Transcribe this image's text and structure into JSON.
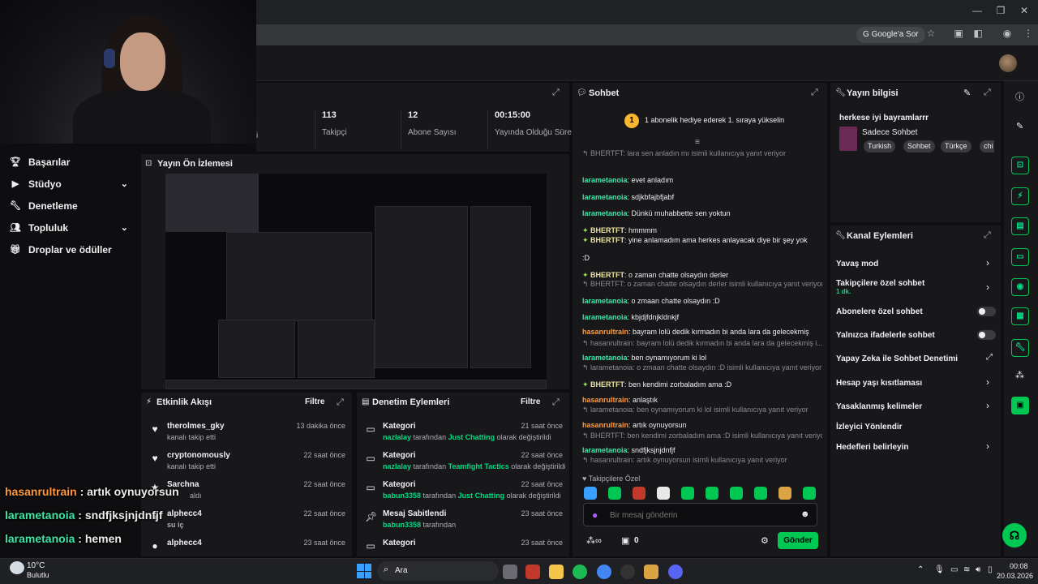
{
  "browser": {
    "google_sor": "Google'a Sor"
  },
  "nav": {
    "items": [
      {
        "label": "Başarılar",
        "icon": "trophy-icon"
      },
      {
        "label": "Stüdyo",
        "icon": "video-icon"
      },
      {
        "label": "Denetleme",
        "icon": "wrench-icon"
      },
      {
        "label": "Topluluk",
        "icon": "people-icon"
      },
      {
        "label": "Droplar ve ödüller",
        "icon": "gift-icon"
      }
    ]
  },
  "stats": {
    "stat2_suffix": "i",
    "items": [
      {
        "value": "113",
        "label": "Takipçi"
      },
      {
        "value": "12",
        "label": "Abone Sayısı"
      },
      {
        "value": "00:15:00",
        "label": "Yayında Olduğu Süre"
      }
    ]
  },
  "preview": {
    "title": "Yayın Ön İzlemesi"
  },
  "activity": {
    "title": "Etkinlik Akışı",
    "filter": "Filtre",
    "items": [
      {
        "user": "therolmes_gky",
        "desc": "kanalı takip etti",
        "time": "13 dakika önce"
      },
      {
        "user": "cryptonomously",
        "desc": "kanalı takip etti",
        "time": "22 saat önce"
      },
      {
        "user": "Sarchna",
        "desc": "aldı",
        "time": "22 saat önce"
      },
      {
        "user": "alphecc4",
        "desc": "su iç",
        "time": "22 saat önce"
      },
      {
        "user": "alphecc4",
        "desc": "",
        "time": "23 saat önce"
      }
    ]
  },
  "moderation": {
    "title": "Denetim Eylemleri",
    "filter": "Filtre",
    "items": [
      {
        "title": "Kategori",
        "user": "nazlalay",
        "mid": "tarafından",
        "target": "Just Chatting",
        "end": "olarak değiştirildi",
        "time": "21 saat önce"
      },
      {
        "title": "Kategori",
        "user": "nazlalay",
        "mid": "tarafından",
        "target": "Teamfight Tactics",
        "end": "olarak değiştirildi",
        "time": "22 saat önce"
      },
      {
        "title": "Kategori",
        "user": "babun3358",
        "mid": "tarafından",
        "target": "Just Chatting",
        "end": "olarak değiştirildi",
        "time": "22 saat önce"
      },
      {
        "title": "Mesaj Sabitlendi",
        "user": "babun3358",
        "mid": "tarafından",
        "target": "",
        "end": "",
        "time": "23 saat önce"
      },
      {
        "title": "Kategori",
        "user": "",
        "mid": "",
        "target": "",
        "end": "",
        "time": "23 saat önce"
      }
    ]
  },
  "overlay": [
    {
      "name": "hasanrultrain",
      "text": " : artık oynuyorsun"
    },
    {
      "name": "larametanoia",
      "text": " : sndfjksjnjdnfjf"
    },
    {
      "name": "larametanoia",
      "text": " : hemen"
    }
  ],
  "chat": {
    "title": "Sohbet",
    "pinned_rank": "1",
    "pinned_text": "1 abonelik hediye ederek 1. sıraya yükselin",
    "messages": [
      {
        "reply": "BHERTFT: lara sen anladın mı isimli kullanıcıya yanıt veriyor",
        "name": "",
        "text": "",
        "color": "g"
      },
      {
        "reply": "",
        "name": "larametanoia",
        "text": ": evet anladım",
        "color": "g"
      },
      {
        "reply": "",
        "name": "larametanoia",
        "text": ": sdjkbfajbfjabf",
        "color": "g"
      },
      {
        "reply": "",
        "name": "larametanoia",
        "text": ": Dünkü muhabbette sen yoktun",
        "color": "g"
      },
      {
        "reply": "",
        "name": "BHERTFT",
        "text": ": hmmmm",
        "color": "y"
      },
      {
        "reply": "",
        "name": "BHERTFT",
        "text": ": yine anlamadım ama herkes anlayacak diye bir şey yok",
        "color": "y"
      },
      {
        "reply": "",
        "name": "",
        "text": ":D",
        "color": "y"
      },
      {
        "reply": "",
        "name": "BHERTFT",
        "text": ": o zaman chatte olsaydın derler",
        "color": "y"
      },
      {
        "reply": "BHERTFT: o zaman chatte olsaydın derler isimli kullanıcıya yanıt veriyor",
        "name": "",
        "text": "",
        "color": "g"
      },
      {
        "reply": "",
        "name": "larametanoia",
        "text": ": o zmaan chatte olsaydın :D",
        "color": "g"
      },
      {
        "reply": "",
        "name": "larametanoia",
        "text": ": kbjdjfdnjkldnkjf",
        "color": "g"
      },
      {
        "reply": "",
        "name": "hasanrultrain",
        "text": ": bayram lolü dedik kırmadın bi anda lara da gelecekmiş",
        "color": "o"
      },
      {
        "reply": "hasanrultrain: bayram lolü dedik kırmadın bi anda lara da gelecekmiş i...",
        "name": "",
        "text": "",
        "color": "g"
      },
      {
        "reply": "",
        "name": "larametanoia",
        "text": ": ben oynamıyorum ki lol",
        "color": "g"
      },
      {
        "reply": "larametanoia: o zmaan chatte olsaydın :D isimli kullanıcıya yanıt veriyor",
        "name": "",
        "text": "",
        "color": "y"
      },
      {
        "reply": "",
        "name": "BHERTFT",
        "text": ": ben kendimi zorbaladım ama :D",
        "color": "y"
      },
      {
        "reply": "",
        "name": "hasanrultrain",
        "text": ": anlaştık",
        "color": "o"
      },
      {
        "reply": "larametanoia: ben oynamıyorum ki lol isimli kullanıcıya yanıt veriyor",
        "name": "",
        "text": "",
        "color": "o"
      },
      {
        "reply": "",
        "name": "hasanrultrain",
        "text": ": artık oynuyorsun",
        "color": "o"
      },
      {
        "reply": "BHERTFT: ben kendimi zorbaladım ama :D isimli kullanıcıya yanıt veriyor",
        "name": "",
        "text": "",
        "color": "g"
      },
      {
        "reply": "",
        "name": "larametanoia",
        "text": ": sndfjksjnjdnfjf",
        "color": "g"
      },
      {
        "reply": "hasanrultrain: artık oynuyorsun isimli kullanıcıya yanıt veriyor",
        "name": "",
        "text": "",
        "color": "g"
      },
      {
        "reply": "",
        "name": "larametanoia",
        "text": ": hemen",
        "color": "g"
      }
    ],
    "followers_only": "Takipçilere Özel",
    "placeholder": "Bir mesaj gönderin",
    "points": "0",
    "send": "Gönder"
  },
  "info": {
    "title": "Yayın bilgisi",
    "stream_title": "herkese iyi bayramlarrr",
    "category": "Sadece Sohbet",
    "tags": [
      "Turkish",
      "Sohbet",
      "Türkçe",
      "chi"
    ]
  },
  "actions": {
    "title": "Kanal Eylemleri",
    "items": [
      {
        "label": "Yavaş mod",
        "type": "arrow"
      },
      {
        "label": "Takipçilere özel sohbet",
        "sub": "1 dk.",
        "type": "arrow"
      },
      {
        "label": "Abonelere özel sohbet",
        "type": "toggle"
      },
      {
        "label": "Yalnızca ifadelerle sohbet",
        "type": "toggle"
      },
      {
        "label": "Yapay Zeka ile Sohbet Denetimi",
        "type": "ext"
      },
      {
        "label": "Hesap yaşı kısıtlaması",
        "type": "arrow"
      },
      {
        "label": "Yasaklanmış kelimeler",
        "type": "arrow"
      },
      {
        "label": "İzleyici Yönlendir",
        "type": "none"
      },
      {
        "label": "Hedefleri belirleyin",
        "type": "arrow"
      }
    ]
  },
  "taskbar": {
    "weather_temp": "10°C",
    "weather_desc": "Bulutlu",
    "search": "Ara",
    "time": "00:08",
    "date": "20.03.2026"
  },
  "colors": {
    "accent": "#00c853",
    "green_name": "#3ce7a8",
    "orange_name": "#ff9a3d",
    "bg": "#0e0e10",
    "panel": "#18181b"
  }
}
